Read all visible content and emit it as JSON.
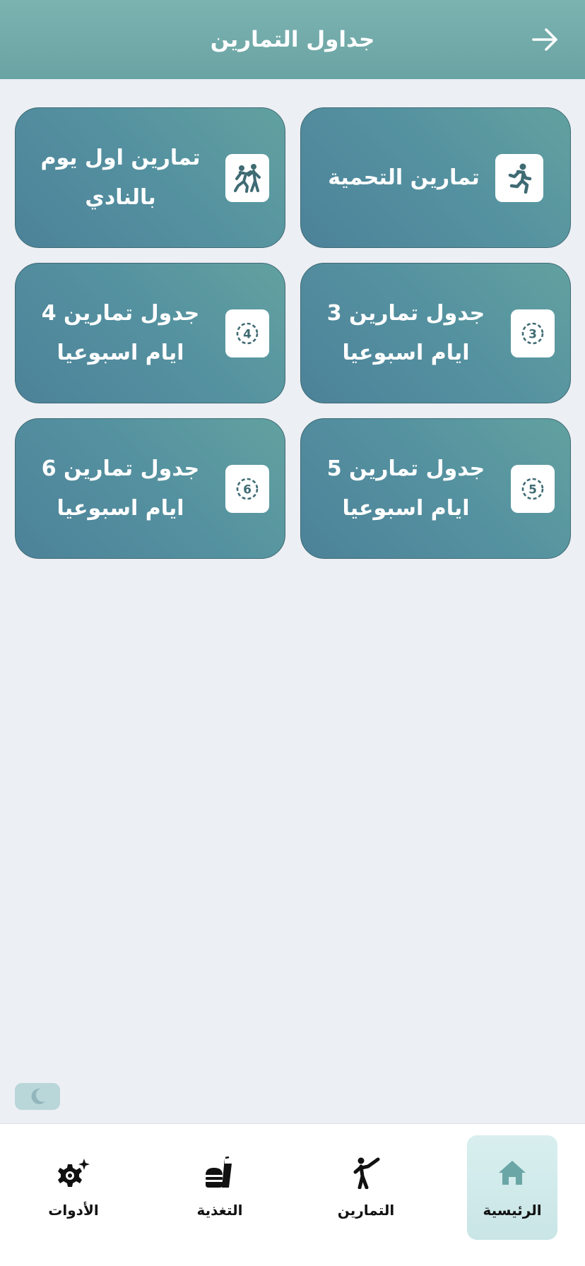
{
  "header": {
    "title": "جداول التمارين",
    "back_icon": "arrow-right-icon"
  },
  "cards": [
    {
      "label": "تمارين التحمية",
      "icon": "running-icon"
    },
    {
      "label": "تمارين اول يوم بالنادي",
      "icon": "sparring-icon"
    },
    {
      "label": "جدول تمارين 3 ايام اسبوعيا",
      "icon": "circled-3-icon",
      "number": "3"
    },
    {
      "label": "جدول تمارين 4 ايام اسبوعيا",
      "icon": "circled-4-icon",
      "number": "4"
    },
    {
      "label": "جدول تمارين 5 ايام اسبوعيا",
      "icon": "circled-5-icon",
      "number": "5"
    },
    {
      "label": "جدول تمارين 6 ايام اسبوعيا",
      "icon": "circled-6-icon",
      "number": "6"
    }
  ],
  "theme_toggle": {
    "icon": "moon-icon"
  },
  "bottom_nav": {
    "items": [
      {
        "label": "الرئيسية",
        "icon": "home-icon",
        "active": true
      },
      {
        "label": "التمارين",
        "icon": "martial-arts-icon",
        "active": false
      },
      {
        "label": "التغذية",
        "icon": "food-icon",
        "active": false
      },
      {
        "label": "الأدوات",
        "icon": "gear-sparkle-icon",
        "active": false
      }
    ]
  },
  "colors": {
    "header": "#72adac",
    "card": "#5592a0",
    "background": "#eceff4",
    "icon_dark": "#3f6b73",
    "nav_active": "#d3ebec"
  }
}
